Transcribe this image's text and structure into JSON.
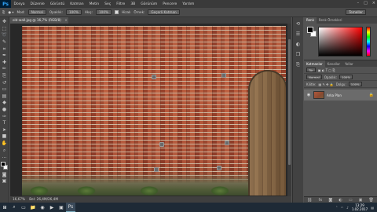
{
  "app": {
    "logo": "Ps"
  },
  "menu": [
    "Dosya",
    "Düzenle",
    "Görüntü",
    "Katman",
    "Metin",
    "Seç",
    "Filtre",
    "3B",
    "Görünüm",
    "Pencere",
    "Yardım"
  ],
  "window_controls": {
    "minimize": "–",
    "maximize": "□",
    "close": "×"
  },
  "options": {
    "mode_label": "Mod:",
    "mode_value": "Normal",
    "opacity_label": "Opaklık:",
    "opacity_value": "100%",
    "flow_label": "Akış:",
    "flow_value": "100%",
    "aligned_label": "Hizalı",
    "sample_label": "Örnek:",
    "sample_value": "Geçerli Katman",
    "workspace": "Temeller"
  },
  "document": {
    "tab_title": "old-wall.jpg @ 16,7% (RGB/8)",
    "close": "×"
  },
  "status": {
    "zoom": "16,67%",
    "doc": "Bel: 26,4M/26,4M"
  },
  "colors": {
    "accent": "#31a8ff",
    "panel": "#535353",
    "taskbar": "#1e2a36"
  },
  "toolbar_icons": [
    "move-icon",
    "marquee-icon",
    "lasso-icon",
    "quick-select-icon",
    "crop-icon",
    "eyedropper-icon",
    "healing-brush-icon",
    "brush-icon",
    "clone-stamp-icon",
    "history-brush-icon",
    "eraser-icon",
    "gradient-icon",
    "blur-icon",
    "dodge-icon",
    "pen-icon",
    "type-icon",
    "path-select-icon",
    "rectangle-icon",
    "hand-icon",
    "zoom-icon",
    "more-tools-icon"
  ],
  "color_panel": {
    "tabs": [
      "Renk",
      "Renk Örnekleri"
    ]
  },
  "layers_panel": {
    "tabs": [
      "Katmanlar",
      "Kanallar",
      "Yollar"
    ],
    "filter_label": "Tür",
    "blend_mode": "Normal",
    "opacity_label": "Opaklık:",
    "opacity_value": "100%",
    "lock_label": "Kilitle:",
    "fill_label": "Dolgu:",
    "fill_value": "100%",
    "layer_name": "Arka Plan"
  },
  "taskbar": {
    "clock_time": "13:29",
    "clock_date": "1.02.2017"
  }
}
